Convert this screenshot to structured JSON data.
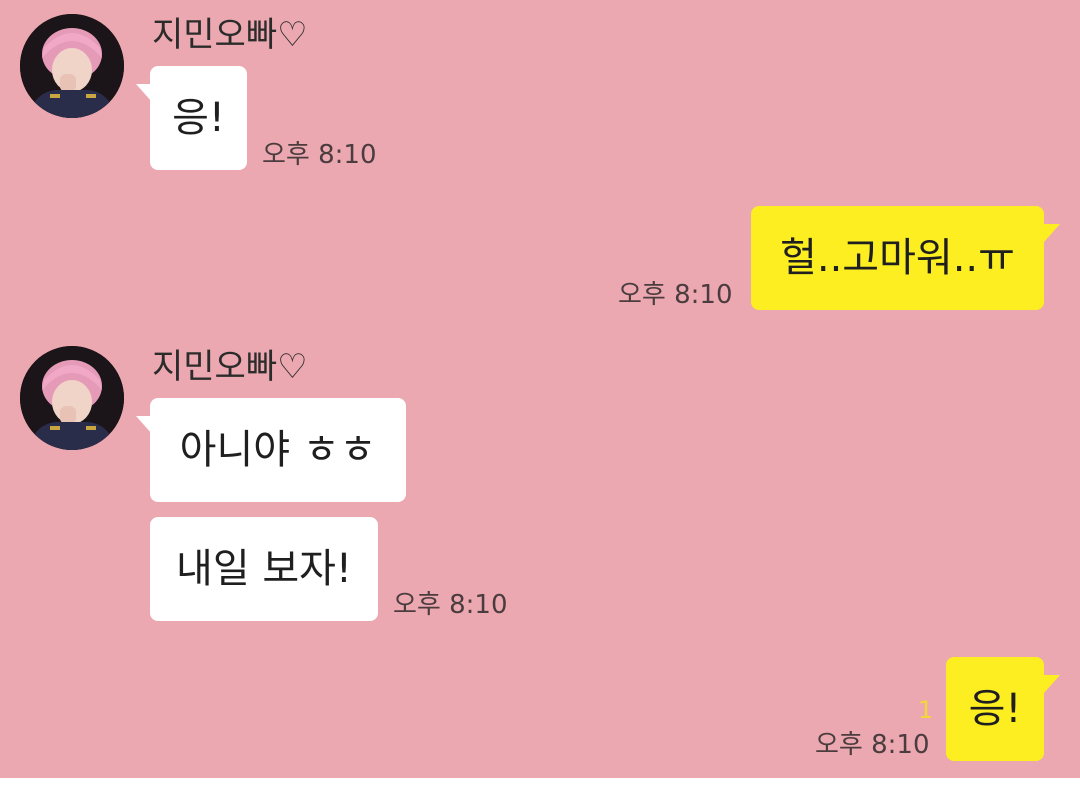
{
  "messages": [
    {
      "sender": "지민오빠♡",
      "text": "응!",
      "time": "오후 8:10"
    },
    {
      "text": "헐..고마워..ㅠ",
      "time": "오후 8:10"
    },
    {
      "sender": "지민오빠♡",
      "text": "아니야 ㅎㅎ"
    },
    {
      "text": "내일 보자!",
      "time": "오후 8:10"
    },
    {
      "text": "응!",
      "time": "오후 8:10",
      "unread_count": "1"
    }
  ],
  "colors": {
    "chat_background": "#eca8b0",
    "incoming_bubble": "#ffffff",
    "outgoing_bubble": "#fcee21",
    "unread_count": "#f3d63a"
  },
  "icons": {
    "avatar": "profile-photo-avatar"
  }
}
